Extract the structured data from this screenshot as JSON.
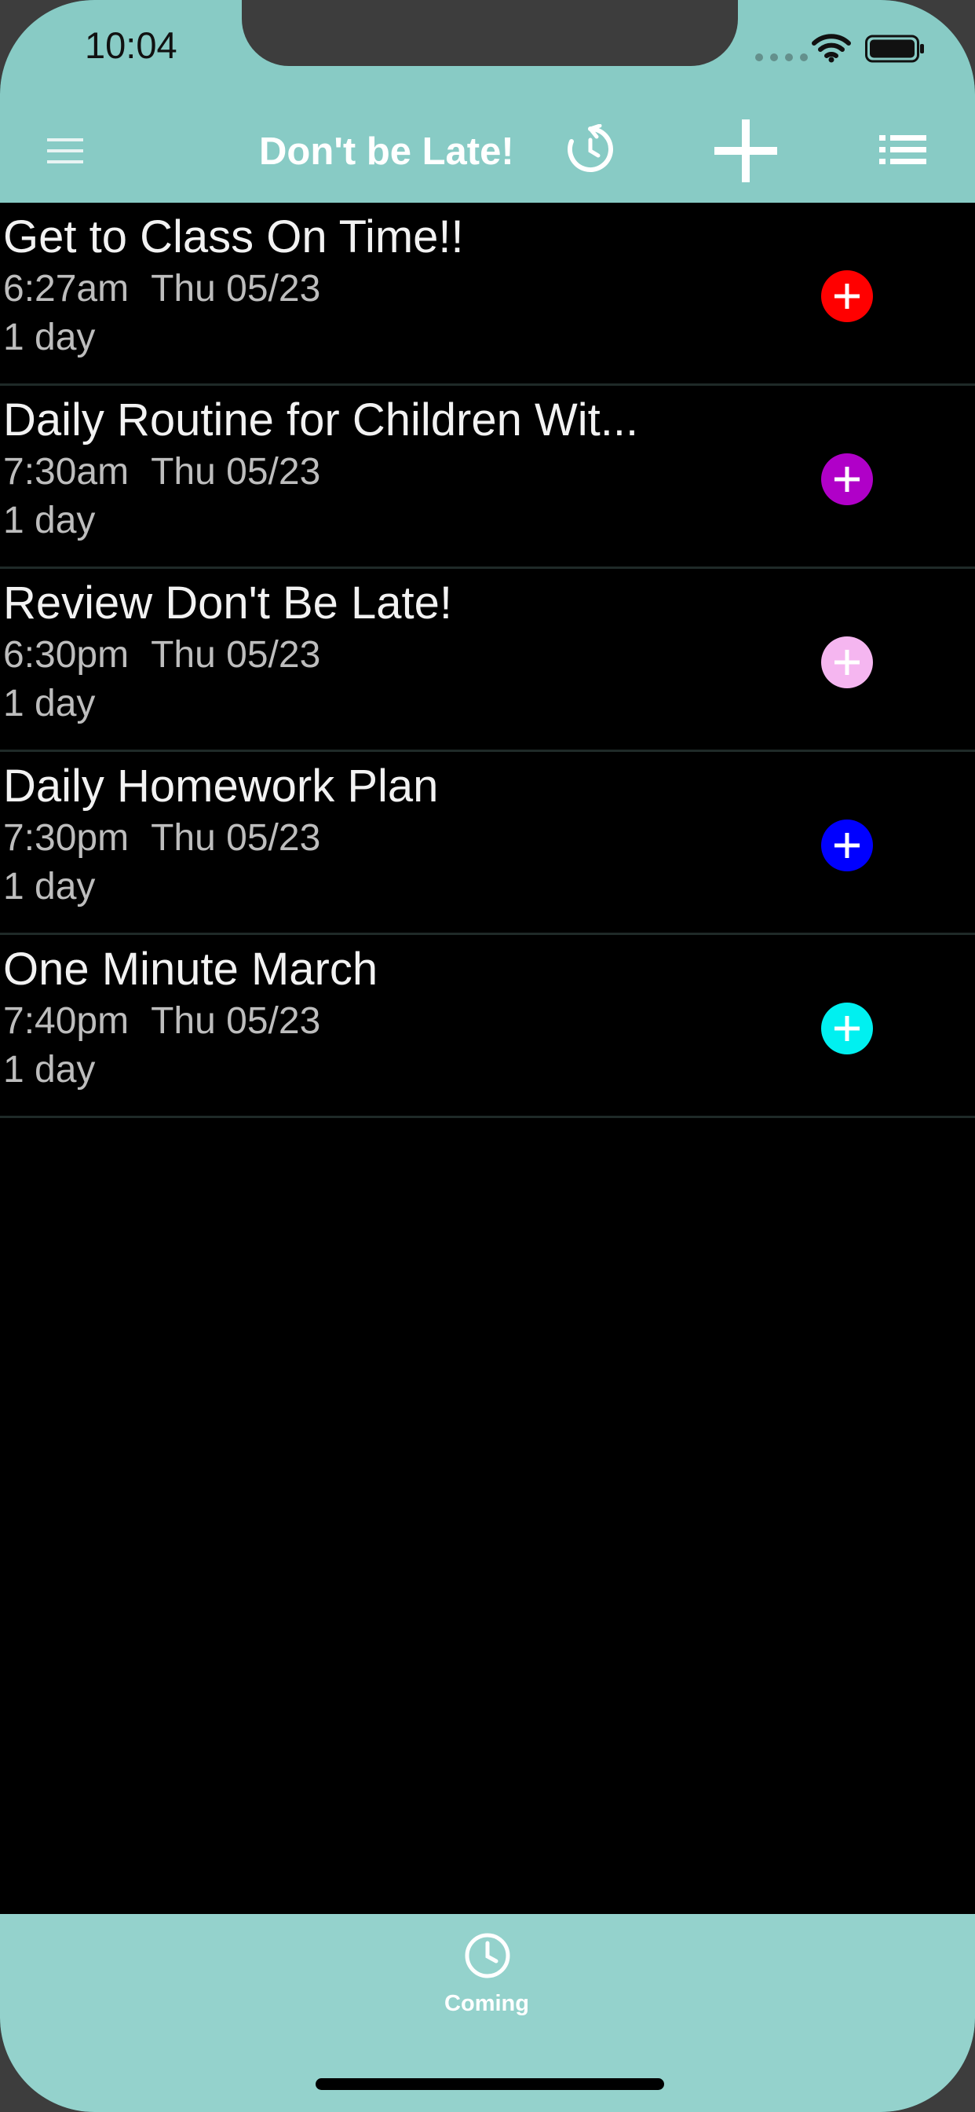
{
  "status_bar": {
    "time": "10:04"
  },
  "nav": {
    "title": "Don't be Late!",
    "menu_icon": "hamburger-icon",
    "history_icon": "history-icon",
    "add_icon": "plus-icon",
    "list_icon": "list-icon"
  },
  "items": [
    {
      "title": "Get to Class On Time!!",
      "time": "6:27am",
      "date": "Thu 05/23",
      "duration": "1 day",
      "color": "#ff0000"
    },
    {
      "title": "Daily Routine for Children Wit...",
      "time": "7:30am",
      "date": "Thu 05/23",
      "duration": "1 day",
      "color": "#b000c8"
    },
    {
      "title": "Review Don't Be Late!",
      "time": "6:30pm",
      "date": "Thu 05/23",
      "duration": "1 day",
      "color": "#f5b6f0"
    },
    {
      "title": "Daily Homework Plan",
      "time": "7:30pm",
      "date": "Thu 05/23",
      "duration": "1 day",
      "color": "#0000ff"
    },
    {
      "title": "One Minute March",
      "time": "7:40pm",
      "date": "Thu 05/23",
      "duration": "1 day",
      "color": "#00f0f0"
    }
  ],
  "tabbar": {
    "coming_label": "Coming",
    "coming_icon": "clock-icon"
  },
  "colors": {
    "header_bg": "#88cbc5",
    "tabbar_bg": "#94d2cc",
    "list_bg": "#000000"
  }
}
